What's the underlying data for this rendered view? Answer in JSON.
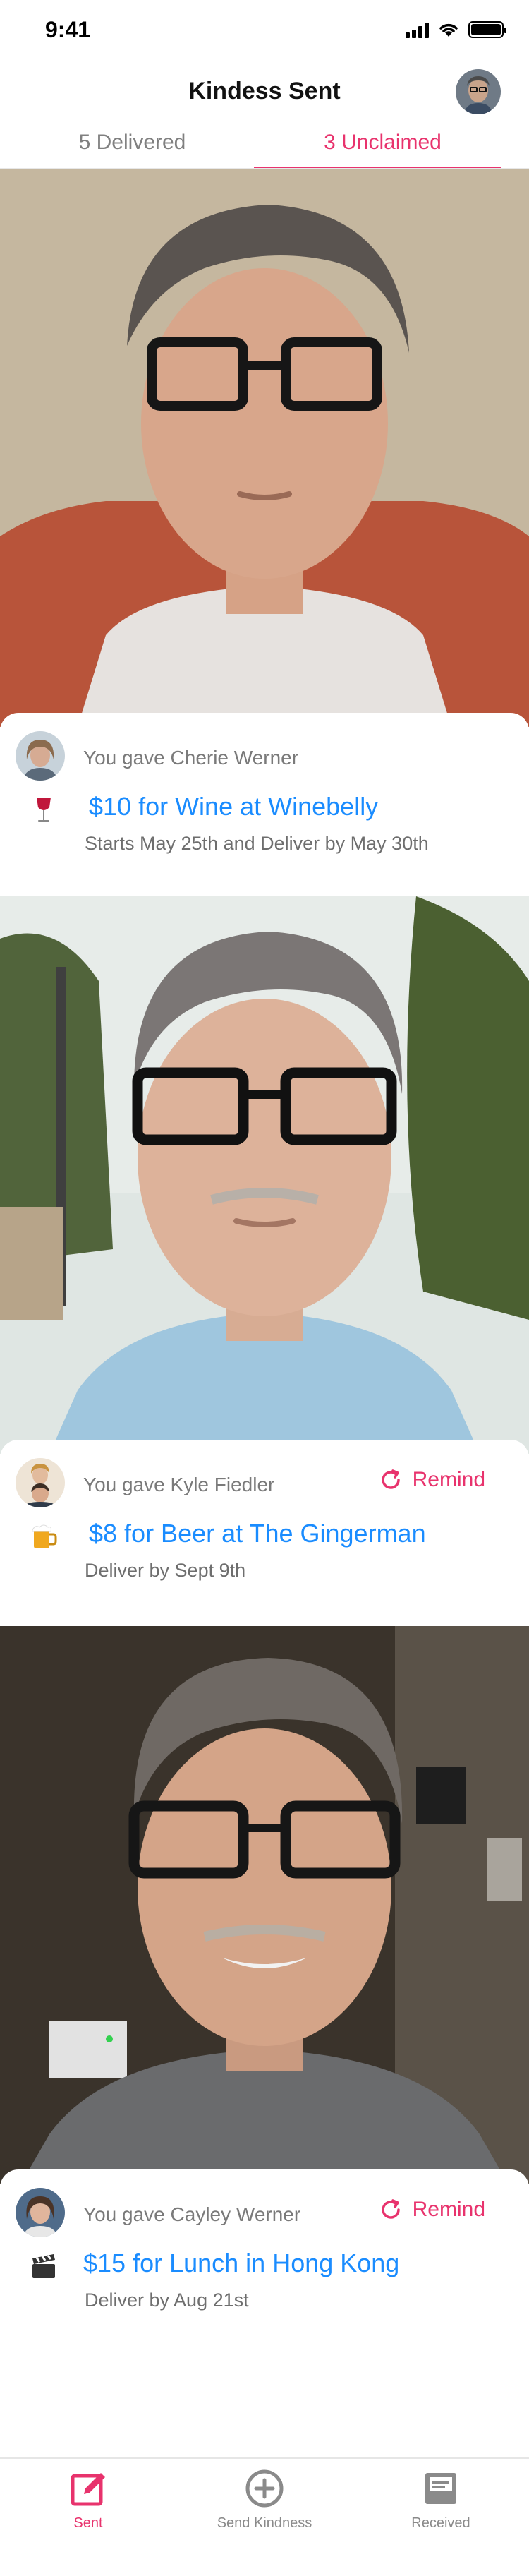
{
  "status_bar": {
    "time": "9:41"
  },
  "header": {
    "title": "Kindess Sent",
    "tabs": [
      {
        "label": "5 Delivered",
        "active": false
      },
      {
        "label": "3 Unclaimed",
        "active": true
      }
    ]
  },
  "cards": [
    {
      "photo": "man-with-glasses-selfie-indoor",
      "gave_text": "You gave Cherie Werner",
      "remind_label": "",
      "item_icon": "wine-glass-icon",
      "gift_title": "$10 for Wine at Winebelly",
      "gift_subtitle": "Starts May 25th and Deliver by May 30th"
    },
    {
      "photo": "man-with-glasses-selfie-outdoor",
      "gave_text": "You gave Kyle Fiedler",
      "remind_label": "Remind",
      "item_icon": "beer-mug-icon",
      "gift_title": "$8 for Beer at The Gingerman",
      "gift_subtitle": "Deliver by Sept 9th"
    },
    {
      "photo": "man-with-glasses-selfie-dim-room",
      "gave_text": "You gave Cayley Werner",
      "remind_label": "Remind",
      "item_icon": "clapperboard-icon",
      "gift_title": "$15 for Lunch in Hong Kong",
      "gift_subtitle": "Deliver by Aug 21st"
    }
  ],
  "tab_bar": {
    "items": [
      {
        "label": "Sent",
        "icon": "compose-icon",
        "active": true
      },
      {
        "label": "Send Kindness",
        "icon": "plus-circle-icon",
        "active": false
      },
      {
        "label": "Received",
        "icon": "inbox-icon",
        "active": false
      }
    ]
  },
  "colors": {
    "accent": "#e8336d",
    "link": "#1a8cff",
    "muted": "#7a7a7a"
  }
}
